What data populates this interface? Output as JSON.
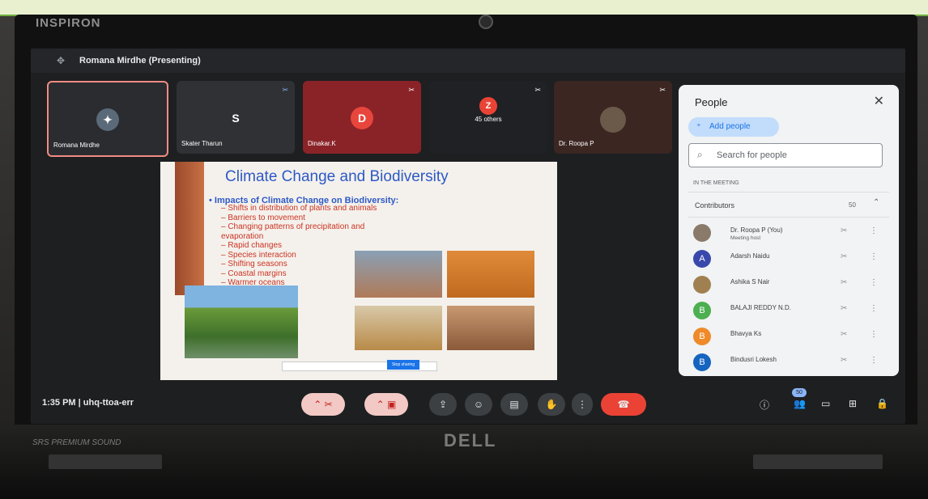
{
  "laptop": {
    "brand_top": "INSPIRON",
    "logo": "DELL",
    "speaker_label": "SRS PREMIUM SOUND"
  },
  "presenter": {
    "label": "Romana Mirdhe (Presenting)"
  },
  "tiles": [
    {
      "name": "Romana Mirdhe",
      "avatar_letter": "",
      "color": "#5a6a78"
    },
    {
      "name": "Skater Tharun",
      "avatar_letter": "S",
      "color": "#3c4043"
    },
    {
      "name": "Dinakar.K",
      "avatar_letter": "D",
      "color": "#e8453c"
    },
    {
      "name": "45 others",
      "avatar_letter": "Z",
      "color": "#ea4335"
    },
    {
      "name": "Dr. Roopa P",
      "avatar_letter": "",
      "color": "#6b5a4a"
    }
  ],
  "slide": {
    "title": "Climate Change and Biodiversity",
    "main_bullet": "Impacts of Climate Change on Biodiversity:",
    "points": [
      "– Shifts in distribution of plants and animals",
      "– Barriers to movement",
      "– Changing patterns of precipitation and",
      "   evaporation",
      "– Rapid changes",
      "– Species interaction",
      "– Shifting seasons",
      "– Coastal margins",
      "– Warmer oceans"
    ],
    "button": "Stop sharing"
  },
  "people": {
    "title": "People",
    "add_label": "Add people",
    "search_placeholder": "Search for people",
    "in_meeting": "IN THE MEETING",
    "contributors_label": "Contributors",
    "contributors_count": "50",
    "list": [
      {
        "name": "Dr. Roopa P (You)",
        "sub": "Meeting host",
        "letter": "",
        "color": "#8a7a6a"
      },
      {
        "name": "Adarsh Naidu",
        "sub": "",
        "letter": "A",
        "color": "#3949ab"
      },
      {
        "name": "Ashika S Nair",
        "sub": "",
        "letter": "",
        "color": "#a08050"
      },
      {
        "name": "BALAJI REDDY N.D.",
        "sub": "",
        "letter": "B",
        "color": "#4caf50"
      },
      {
        "name": "Bhavya Ks",
        "sub": "",
        "letter": "B",
        "color": "#ef8a2a"
      },
      {
        "name": "Bindusri Lokesh",
        "sub": "",
        "letter": "B",
        "color": "#1565c0"
      }
    ]
  },
  "bottom": {
    "time_code": "1:35 PM  |  uhq-ttoa-err",
    "people_badge": "50"
  }
}
